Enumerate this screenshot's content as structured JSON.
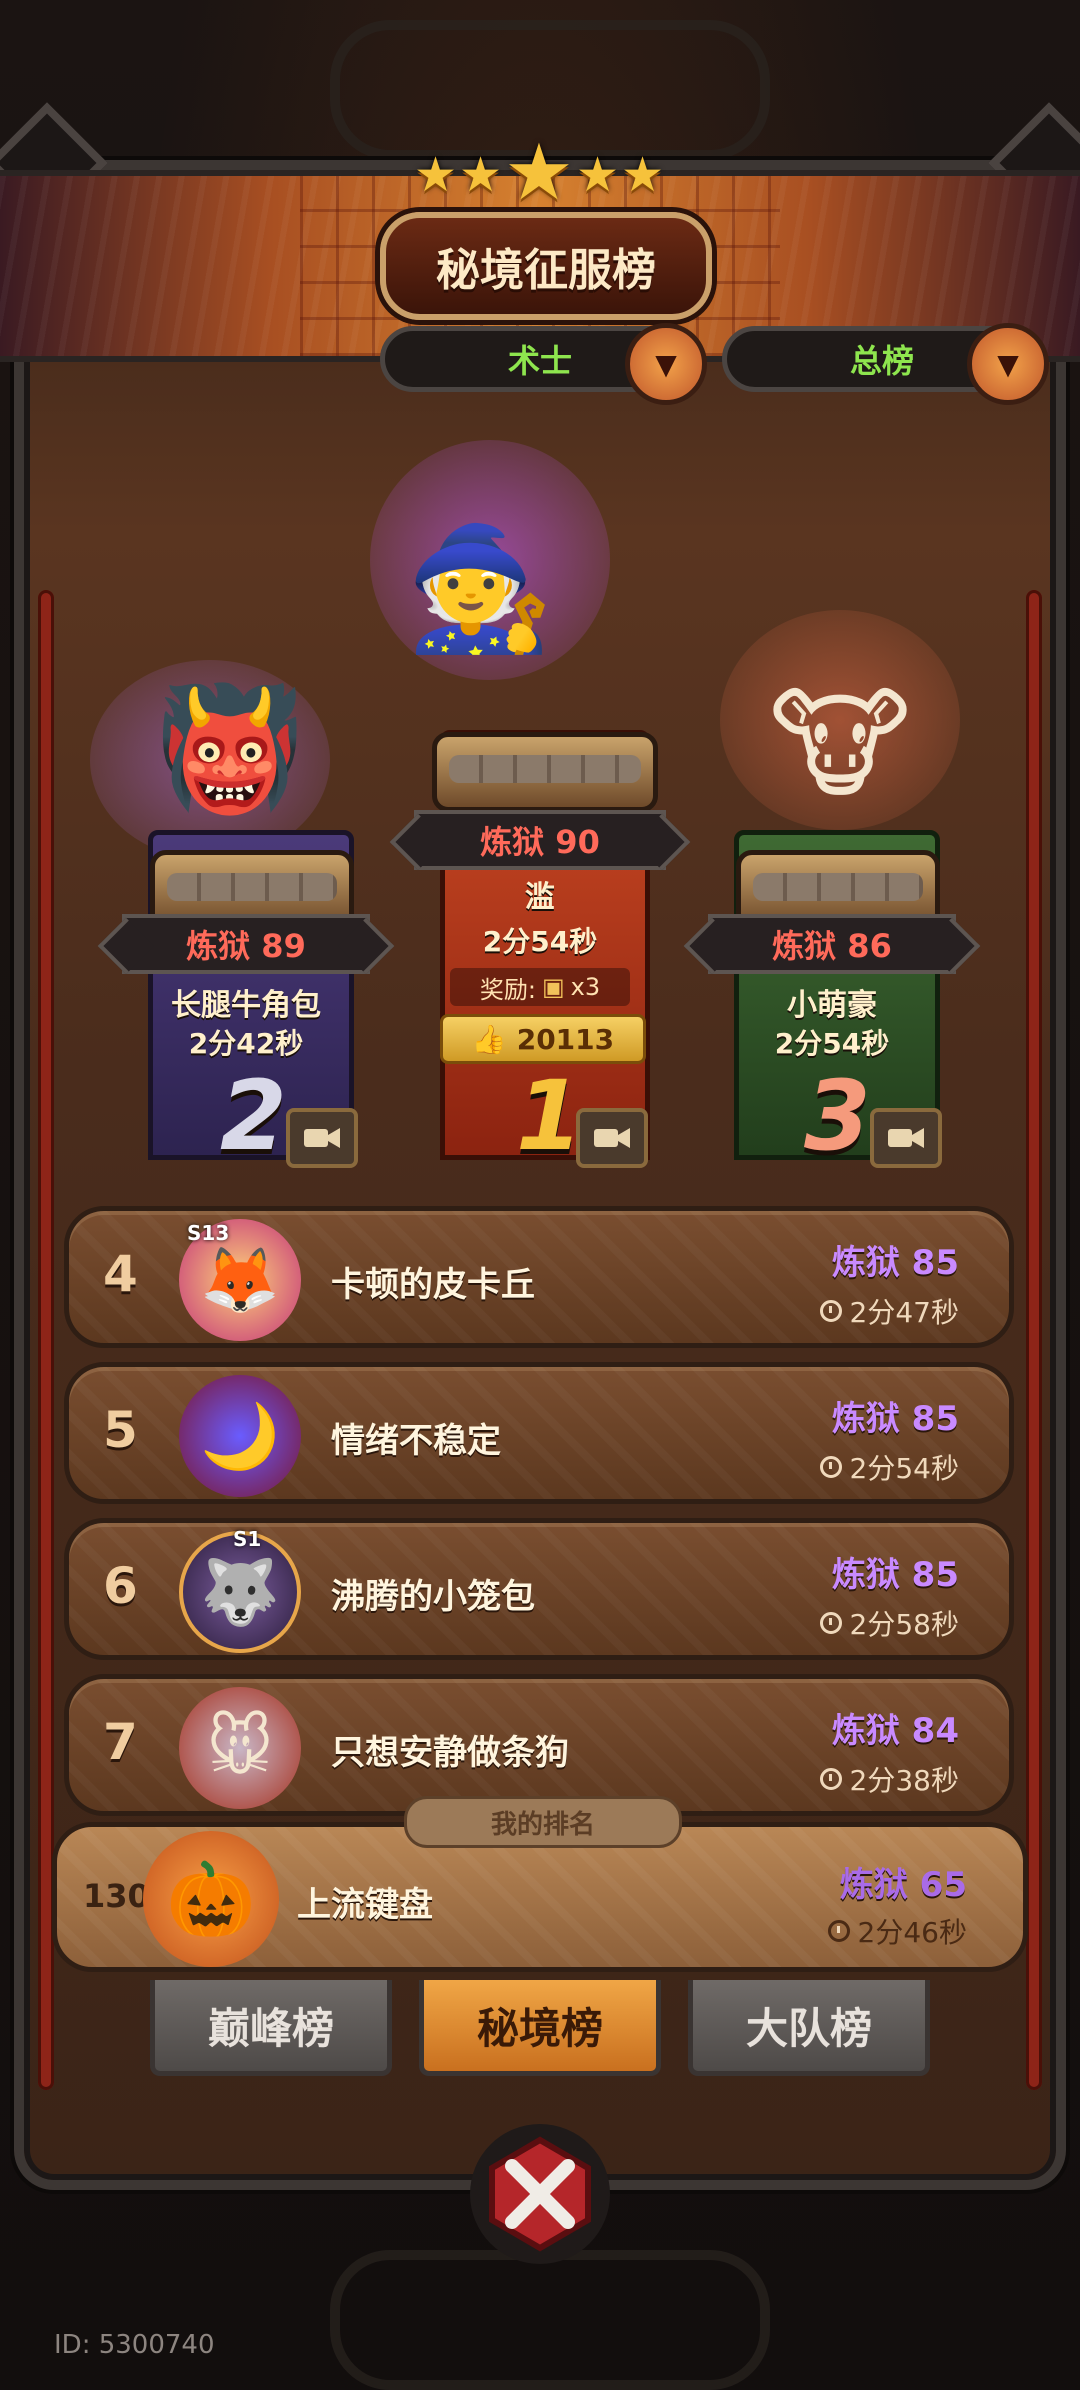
{
  "title": "秘境征服榜",
  "filters": {
    "class_label": "术士",
    "range_label": "总榜"
  },
  "podium": [
    {
      "rank": "1",
      "level": "炼狱 90",
      "name": "滥",
      "time": "2分54秒",
      "reward_label": "奖励:",
      "reward_qty": "x3",
      "likes": "20113"
    },
    {
      "rank": "2",
      "level": "炼狱 89",
      "name": "长腿牛角包",
      "time": "2分42秒"
    },
    {
      "rank": "3",
      "level": "炼狱 86",
      "name": "小萌豪",
      "time": "2分54秒"
    }
  ],
  "list": [
    {
      "rank": "4",
      "name": "卡顿的皮卡丘",
      "level": "炼狱 85",
      "time": "2分47秒",
      "badge": "S13"
    },
    {
      "rank": "5",
      "name": "情绪不稳定",
      "level": "炼狱 85",
      "time": "2分54秒",
      "badge": ""
    },
    {
      "rank": "6",
      "name": "沸腾的小笼包",
      "level": "炼狱 85",
      "time": "2分58秒",
      "badge": "S1"
    },
    {
      "rank": "7",
      "name": "只想安静做条狗",
      "level": "炼狱 84",
      "time": "2分38秒",
      "badge": ""
    }
  ],
  "my_rank": {
    "label": "我的排名",
    "rank": "130",
    "name": "上流键盘",
    "level": "炼狱 65",
    "time": "2分46秒"
  },
  "tabs": [
    {
      "label": "巅峰榜",
      "active": false
    },
    {
      "label": "秘境榜",
      "active": true
    },
    {
      "label": "大队榜",
      "active": false
    }
  ],
  "user_id": "ID: 5300740",
  "colors": {
    "level_red": "#ff6a5a",
    "level_purple": "#c98aff",
    "filter_green": "#8ee54e",
    "tab_active": "#e08a30"
  }
}
